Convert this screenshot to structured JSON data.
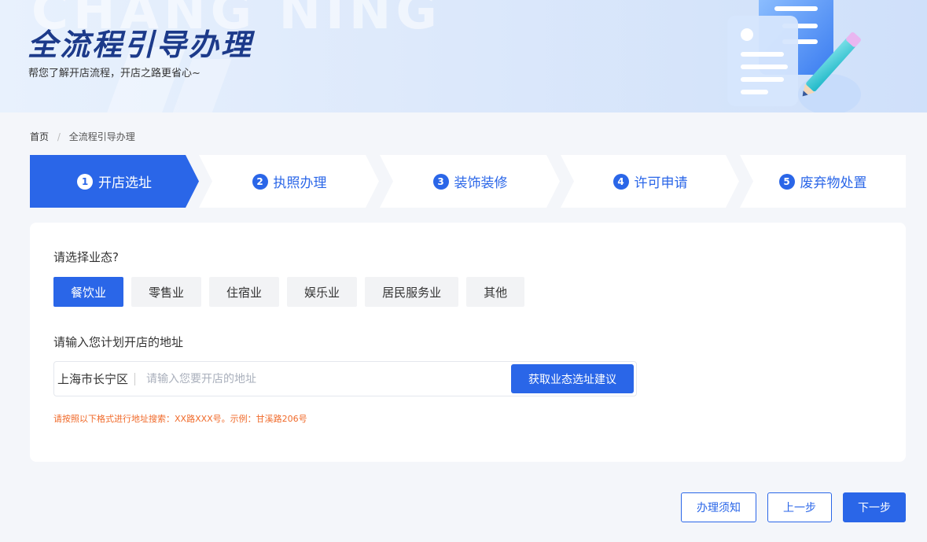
{
  "banner": {
    "watermark": "CHANG NING",
    "title": "全流程引导办理",
    "subtitle": "帮您了解开店流程，开店之路更省心~"
  },
  "breadcrumb": {
    "home": "首页",
    "separator": "/",
    "current": "全流程引导办理"
  },
  "steps": [
    {
      "num": "1",
      "label": "开店选址",
      "active": true
    },
    {
      "num": "2",
      "label": "执照办理",
      "active": false
    },
    {
      "num": "3",
      "label": "装饰装修",
      "active": false
    },
    {
      "num": "4",
      "label": "许可申请",
      "active": false
    },
    {
      "num": "5",
      "label": "废弃物处置",
      "active": false
    }
  ],
  "form": {
    "business_question": "请选择业态?",
    "business_types": [
      {
        "label": "餐饮业",
        "selected": true
      },
      {
        "label": "零售业",
        "selected": false
      },
      {
        "label": "住宿业",
        "selected": false
      },
      {
        "label": "娱乐业",
        "selected": false
      },
      {
        "label": "居民服务业",
        "selected": false
      },
      {
        "label": "其他",
        "selected": false
      }
    ],
    "address_question": "请输入您计划开店的地址",
    "address_prefix": "上海市长宁区",
    "address_value": "",
    "address_placeholder": "请输入您要开店的地址",
    "suggest_button": "获取业态选址建议",
    "hint": "请按照以下格式进行地址搜索：XX路XXX号。示例：甘溪路206号"
  },
  "actions": {
    "notice": "办理须知",
    "prev": "上一步",
    "next": "下一步"
  },
  "colors": {
    "accent": "#2a66e8",
    "title": "#1c3a8a",
    "hint": "#f06a2a",
    "page_bg": "#f4f6fa"
  }
}
